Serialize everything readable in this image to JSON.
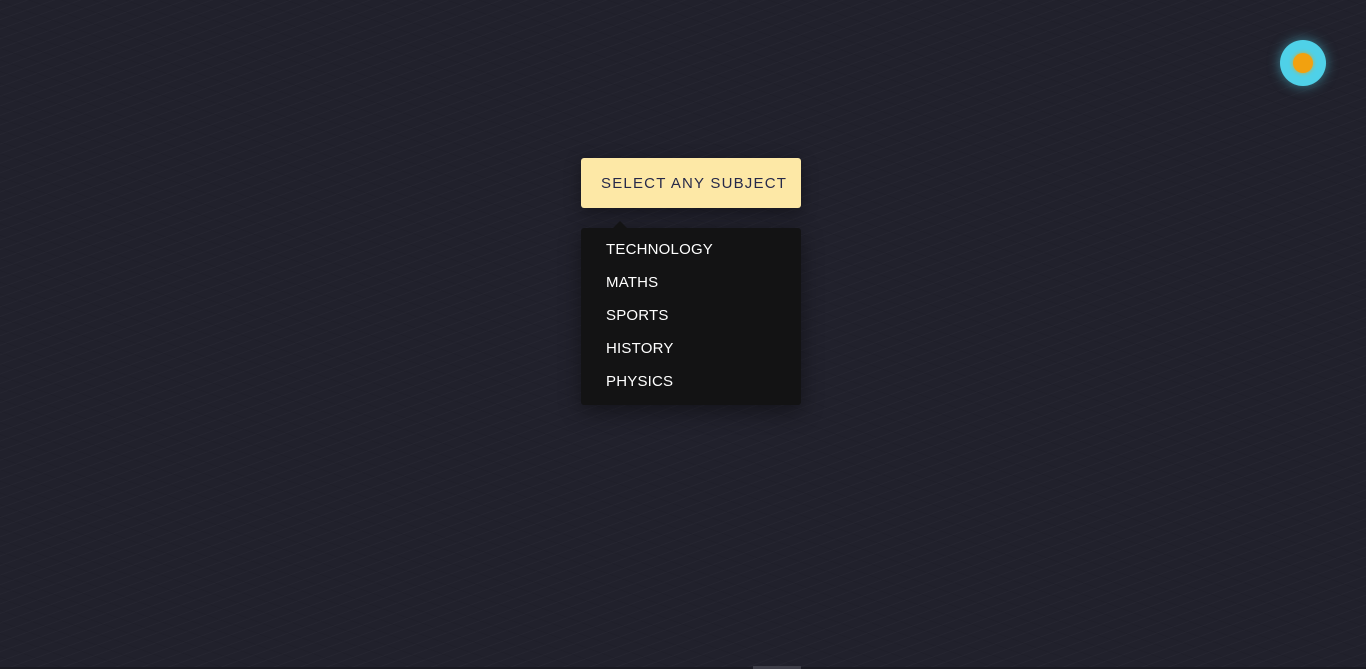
{
  "theme_toggle": {
    "icon": "sun-icon",
    "ring_color": "#4fd1e8",
    "sun_color": "#f2a10f"
  },
  "select": {
    "label": "SELECT ANY SUBJECT",
    "button_color": "#fde8a6",
    "text_color": "#26294a"
  },
  "dropdown": {
    "background": "#131314",
    "items": [
      {
        "label": "TECHNOLOGY"
      },
      {
        "label": "MATHS"
      },
      {
        "label": "SPORTS"
      },
      {
        "label": "HISTORY"
      },
      {
        "label": "PHYSICS"
      }
    ]
  },
  "page": {
    "background": "#21212c"
  }
}
